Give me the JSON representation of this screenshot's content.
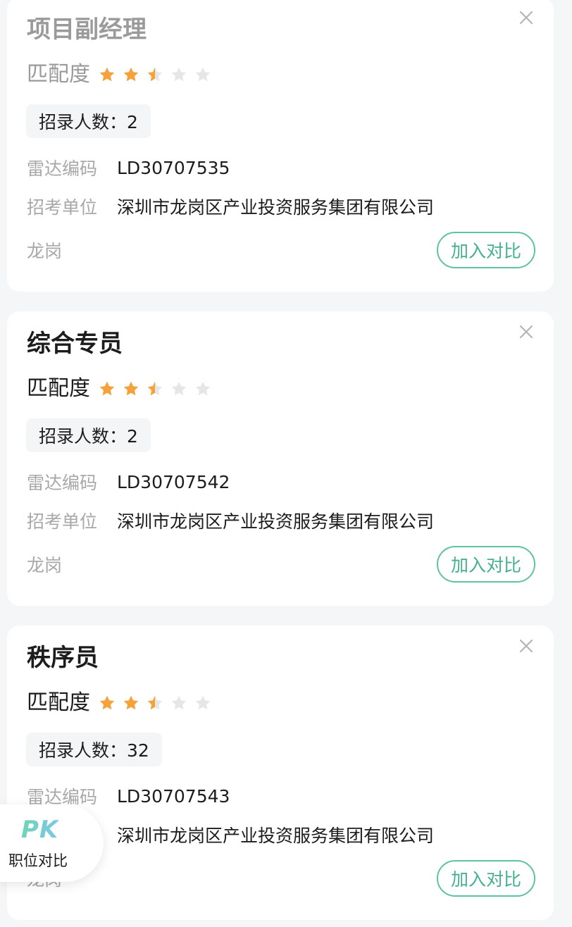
{
  "jobs": [
    {
      "title": "项目副经理",
      "match_label": "匹配度",
      "rating": 2.5,
      "quota": "招录人数：2",
      "code_label": "雷达编码",
      "code": "LD30707535",
      "unit_label": "招考单位",
      "unit": "深圳市龙岗区产业投资服务集团有限公司",
      "location": "龙岗",
      "compare_label": "加入对比"
    },
    {
      "title": "综合专员",
      "match_label": "匹配度",
      "rating": 2.5,
      "quota": "招录人数：2",
      "code_label": "雷达编码",
      "code": "LD30707542",
      "unit_label": "招考单位",
      "unit": "深圳市龙岗区产业投资服务集团有限公司",
      "location": "龙岗",
      "compare_label": "加入对比"
    },
    {
      "title": "秩序员",
      "match_label": "匹配度",
      "rating": 2.5,
      "quota": "招录人数：32",
      "code_label": "雷达编码",
      "code": "LD30707543",
      "unit_label": "招考单位",
      "unit": "深圳市龙岗区产业投资服务集团有限公司",
      "location": "龙岗",
      "compare_label": "加入对比"
    }
  ],
  "pk_float": {
    "logo": "PK",
    "label": "职位对比"
  },
  "colors": {
    "accent": "#45b08f",
    "star_filled": "#f5a23a",
    "star_empty": "#e6e6e6"
  },
  "icons": {
    "close": "close-icon",
    "star": "star-icon"
  }
}
